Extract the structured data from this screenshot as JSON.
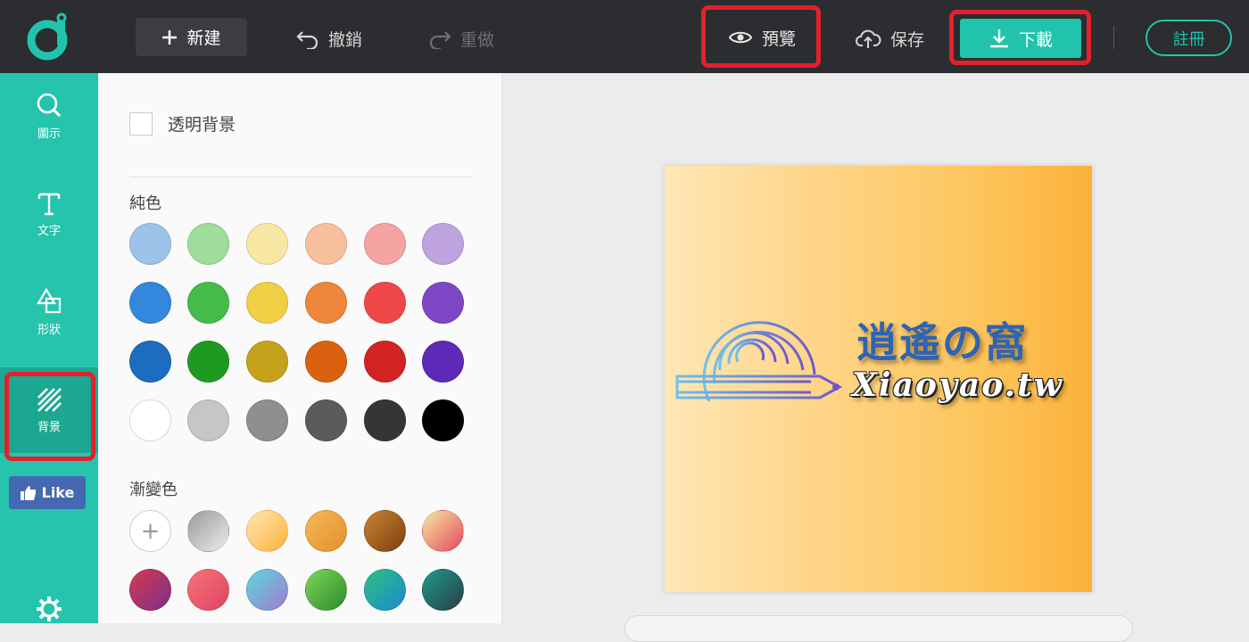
{
  "toolbar": {
    "new_label": "新建",
    "undo_label": "撤銷",
    "redo_label": "重做",
    "preview_label": "預覽",
    "save_label": "保存",
    "download_label": "下載",
    "register_label": "註冊"
  },
  "sidebar": {
    "items": [
      {
        "label": "圖示",
        "icon": "search-icon"
      },
      {
        "label": "文字",
        "icon": "text-icon"
      },
      {
        "label": "形狀",
        "icon": "shapes-icon"
      },
      {
        "label": "背景",
        "icon": "background-icon",
        "active": true
      }
    ],
    "like_label": "Like"
  },
  "panel": {
    "transparent_label": "透明背景",
    "solid_title": "純色",
    "gradient_title": "漸變色",
    "solid_colors": [
      "#9dc3ea",
      "#9fdd9b",
      "#f8e7a3",
      "#f6c19c",
      "#f5a3a3",
      "#bfa3e0",
      "#3388dd",
      "#45bb4a",
      "#f0cf46",
      "#ef873a",
      "#ee4848",
      "#7d47c5",
      "#1c6cc0",
      "#1f9a21",
      "#c4a21b",
      "#d9610f",
      "#d22323",
      "#5e29b7",
      "#ffffff",
      "#c5c6c6",
      "#8f8f8f",
      "#5b5b5c",
      "#343537",
      "#000000"
    ],
    "gradient_colors": [
      [
        "#9a9a9a",
        "#ececec"
      ],
      [
        "#ffe7b5",
        "#fbb23a"
      ],
      [
        "#f3b85a",
        "#e5902a"
      ],
      [
        "#c98434",
        "#7b3f0e"
      ],
      [
        "#f5ea9f",
        "#e6475f"
      ],
      [
        "#d63a4d",
        "#7a2f8a"
      ],
      [
        "#f4737a",
        "#e04461"
      ],
      [
        "#5dd6dc",
        "#a07cd0"
      ],
      [
        "#7cd658",
        "#2e8b2b"
      ],
      [
        "#2fc07f",
        "#1a8ad0"
      ],
      [
        "#1e9c88",
        "#2b3c48"
      ]
    ]
  },
  "canvas": {
    "brand_cn": "逍遙の窩",
    "brand_en": "Xiaoyao.tw"
  },
  "colors": {
    "topbar": "#2b2d30",
    "accent": "#22c3ac",
    "highlight": "#e3202c"
  }
}
